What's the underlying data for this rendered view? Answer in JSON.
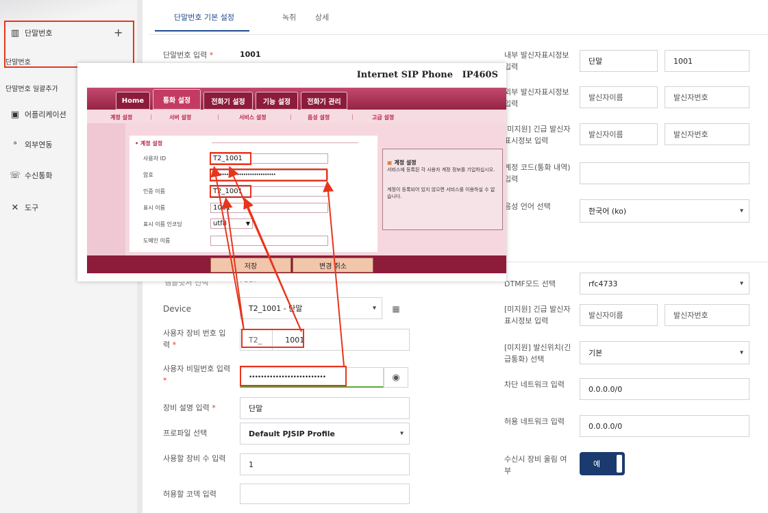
{
  "sidebar": {
    "items": [
      {
        "icon": "building-icon",
        "label": "단말번호",
        "action": "+"
      },
      {
        "label": "단말번호"
      },
      {
        "label": "단말번호 일괄추가"
      },
      {
        "icon": "briefcase-icon",
        "label": "어플리케이션"
      },
      {
        "icon": "antenna-icon",
        "label": "외부연동"
      },
      {
        "icon": "incoming-call-icon",
        "label": "수신통화"
      },
      {
        "icon": "tools-icon",
        "label": "도구"
      }
    ]
  },
  "tabs": [
    {
      "label": "단말번호 기본 설정"
    },
    {
      "label": "녹취"
    },
    {
      "label": "상세"
    }
  ],
  "form_left": {
    "ext_label": "단말번호 입력",
    "ext_value": "1001",
    "template_label": "템플릿처 선택",
    "template_value": "FSSI",
    "device_label": "Device",
    "device_value": "T2_1001 - 단말",
    "user_device_label": "사용자 장비 번호 입력",
    "user_device_prefix": "T2_",
    "user_device_value": "1001",
    "password_label": "사용자 비밀번호 입력",
    "password_value": "••••••••••••••••••••••••••",
    "desc_label": "장비 설명 입력",
    "desc_value": "단말",
    "profile_label": "프로파일 선택",
    "profile_value": "Default PJSIP Profile",
    "device_count_label": "사용할 장비 수 입력",
    "device_count_value": "1",
    "codec_label": "허용할 코덱 입력",
    "codec_value": ""
  },
  "form_right": {
    "internal_cid_label": "내부 발신자표시정보 입력",
    "internal_cid_name": "단말",
    "internal_cid_number": "1001",
    "external_cid_label": "외부 발신자표시정보 입력",
    "external_cid_name": "발신자이름",
    "external_cid_number": "발신자번호",
    "emergency_cid_label": "[미지원] 긴급 발신자표시정보 입력",
    "emergency_cid_name": "발신자이름",
    "emergency_cid_number": "발신자번호",
    "account_code_label": "계정 코드(통화 내역) 입력",
    "voice_lang_label": "음성 언어 선택",
    "voice_lang_value": "한국어 (ko)",
    "dtmf_label": "DTMF모드 선택",
    "dtmf_value": "rfc4733",
    "emergency2_label": "[미지원] 긴급 발신자표시정보 입력",
    "emergency2_name": "발신자이름",
    "emergency2_number": "발신자번호",
    "location_label": "[미지원] 발신위치(긴급통화) 선택",
    "location_value": "기본",
    "deny_label": "차단 네트워크 입력",
    "deny_value": "0.0.0.0/0",
    "permit_label": "허용 네트워크 입력",
    "permit_value": "0.0.0.0/0",
    "ring_label": "수신시 장비 울림 여부",
    "ring_value": "예"
  },
  "popup": {
    "brand": "Internet SIP Phone",
    "model": "IP460S",
    "tabs": [
      "Home",
      "통화 설정",
      "전화기 설정",
      "기능 설정",
      "전화기 관리"
    ],
    "subnav": [
      "계정 설정",
      "서버 설정",
      "서비스 설정",
      "음성 설정",
      "고급 설정"
    ],
    "section": "• 계정 설정",
    "fields": [
      {
        "label": "사용자 ID",
        "value": "T2_1001"
      },
      {
        "label": "암호",
        "value": "•••••••••••••••••••••••••••••"
      },
      {
        "label": "인증 이름",
        "value": "T2_1001"
      },
      {
        "label": "표시 이름",
        "value": "1001"
      },
      {
        "label": "표시 이름 인코딩",
        "value": "utf8"
      },
      {
        "label": "도메인 이름",
        "value": ""
      }
    ],
    "help_title": "계정 설정",
    "help_text1": "서비스에 등록된 각 사용자 계정 정보를 기입하십시오.",
    "help_text2": "계정이 등록되어 있지 않으면 서비스를 이용하실 수 없습니다.",
    "save": "저장",
    "cancel": "변경 취소"
  }
}
